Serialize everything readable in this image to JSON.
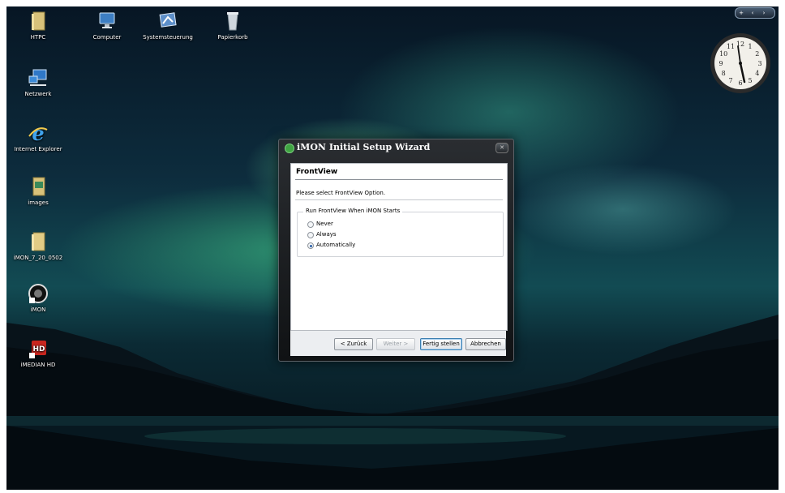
{
  "desktop": {
    "icons": [
      {
        "label": "HTPC",
        "icon": "folder-icon"
      },
      {
        "label": "Computer",
        "icon": "computer-icon"
      },
      {
        "label": "Systemsteuerung",
        "icon": "control-panel-icon"
      },
      {
        "label": "Papierkorb",
        "icon": "recycle-bin-icon"
      },
      {
        "label": "Netzwerk",
        "icon": "network-icon"
      },
      {
        "label": "Internet Explorer",
        "icon": "internet-explorer-icon"
      },
      {
        "label": "images",
        "icon": "folder-icon"
      },
      {
        "label": "iMON_7_20_0502",
        "icon": "folder-icon"
      },
      {
        "label": "iMON",
        "icon": "imon-icon"
      },
      {
        "label": "iMEDIAN HD",
        "icon": "imedian-hd-icon"
      }
    ]
  },
  "gadgets": {
    "tabs": [
      "+",
      "‹",
      "›"
    ],
    "clock": {
      "icon": "analog-clock-icon",
      "numerals": [
        "12",
        "1",
        "2",
        "3",
        "4",
        "5",
        "6",
        "7",
        "8",
        "9",
        "10",
        "11"
      ]
    }
  },
  "dialog": {
    "title": "iMON Initial Setup Wizard",
    "close_icon": "close-icon",
    "page_heading": "FrontView",
    "instruction": "Please select FrontView Option.",
    "group_title": "Run FrontView When iMON Starts",
    "options": [
      {
        "label": "Never",
        "checked": false
      },
      {
        "label": "Always",
        "checked": false
      },
      {
        "label": "Automatically",
        "checked": true
      }
    ],
    "buttons": {
      "back": "< Zurück",
      "next": "Weiter >",
      "finish": "Fertig stellen",
      "cancel": "Abbrechen"
    }
  },
  "colors": {
    "aurora": "#4fd98f",
    "sky": "#0d2c3d",
    "dialog_frame": "#1a1d20",
    "selected_radio": "#2a5fa8"
  }
}
